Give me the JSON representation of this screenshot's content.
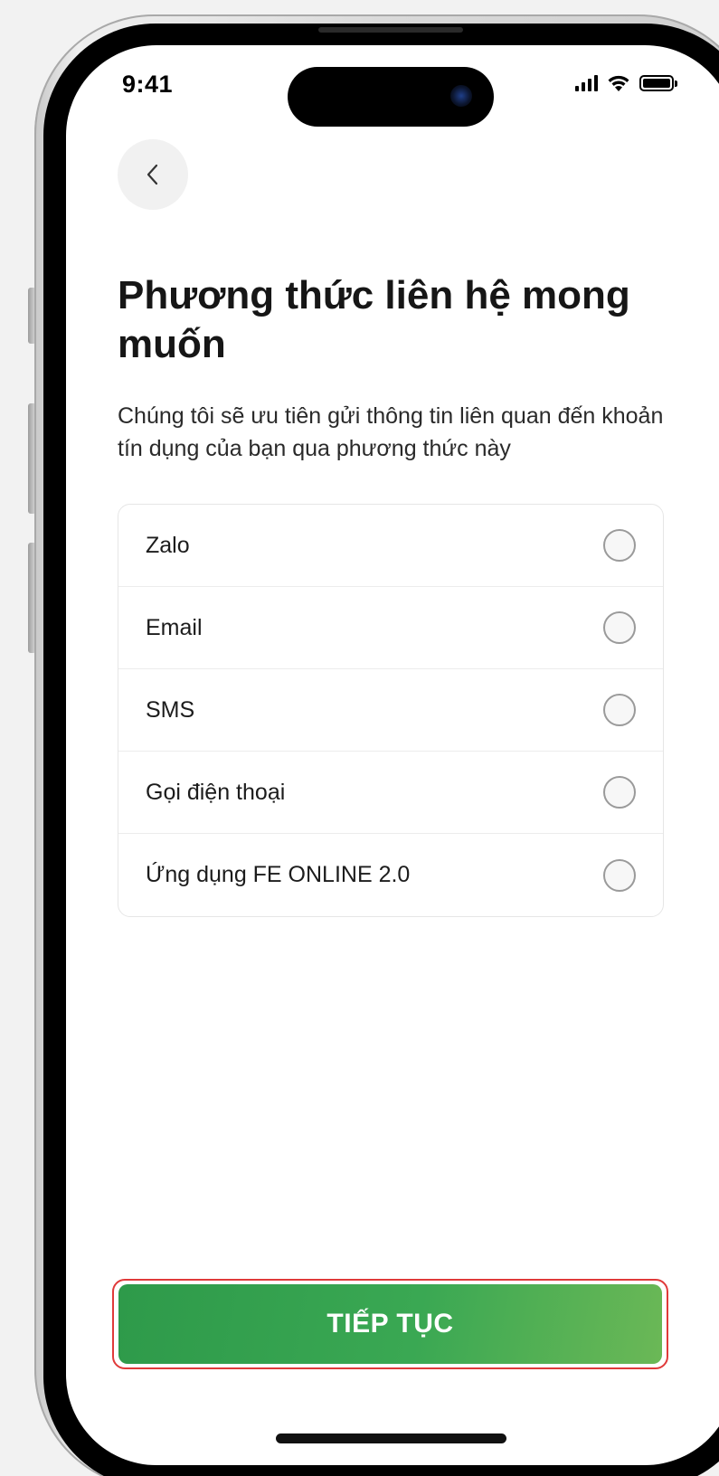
{
  "status_bar": {
    "time": "9:41",
    "icons": [
      "cellular-signal-icon",
      "wifi-icon",
      "battery-icon"
    ]
  },
  "header": {
    "back_icon": "chevron-left-icon"
  },
  "main": {
    "title": "Phương thức liên hệ mong muốn",
    "subtitle": "Chúng tôi sẽ ưu tiên gửi thông tin liên quan đến khoản tín dụng của bạn qua phương thức này",
    "options": [
      {
        "label": "Zalo",
        "selected": false
      },
      {
        "label": "Email",
        "selected": false
      },
      {
        "label": "SMS",
        "selected": false
      },
      {
        "label": "Gọi điện thoại",
        "selected": false
      },
      {
        "label": "Ứng dụng FE ONLINE 2.0",
        "selected": false
      }
    ]
  },
  "footer": {
    "continue_label": "TIẾP TỤC"
  },
  "colors": {
    "primary_green": "#3aa853",
    "highlight_red": "#e03a3a",
    "radio_border": "#9a9a9a"
  }
}
